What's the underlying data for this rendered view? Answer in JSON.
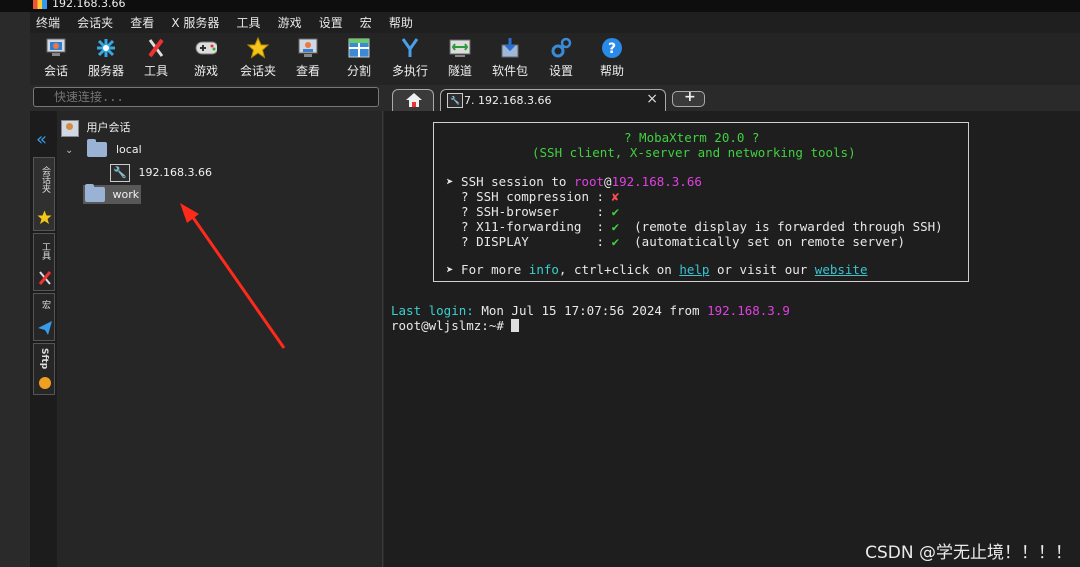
{
  "window": {
    "title": "192.168.3.66"
  },
  "menu": [
    "终端",
    "会话夹",
    "查看",
    "X 服务器",
    "工具",
    "游戏",
    "设置",
    "宏",
    "帮助"
  ],
  "toolbar": [
    {
      "label": "会话",
      "icon": "session-icon"
    },
    {
      "label": "服务器",
      "icon": "servers-icon"
    },
    {
      "label": "工具",
      "icon": "tools-icon"
    },
    {
      "label": "游戏",
      "icon": "games-icon"
    },
    {
      "label": "会话夹",
      "icon": "star-icon"
    },
    {
      "label": "查看",
      "icon": "view-icon"
    },
    {
      "label": "分割",
      "icon": "split-icon"
    },
    {
      "label": "多执行",
      "icon": "multiexec-icon"
    },
    {
      "label": "隧道",
      "icon": "tunnel-icon"
    },
    {
      "label": "软件包",
      "icon": "packages-icon"
    },
    {
      "label": "设置",
      "icon": "settings-icon"
    },
    {
      "label": "帮助",
      "icon": "help-icon"
    }
  ],
  "quick_connect": {
    "placeholder": "快速连接..."
  },
  "side_tabs": [
    "会话夹",
    "工具",
    "宏",
    "Sftp"
  ],
  "tree": {
    "root": "用户会话",
    "folder1": "local",
    "session": "192.168.3.66",
    "folder2": "work"
  },
  "tabs": {
    "active": "7. 192.168.3.66",
    "close": "×"
  },
  "terminal": {
    "banner_title": "? MobaXterm 20.0 ?",
    "banner_sub": "(SSH client, X-server and networking tools)",
    "ssh_prefix": "➤ SSH session to ",
    "ssh_user": "root",
    "ssh_at": "@",
    "ssh_host": "192.168.3.66",
    "f1_label": "  ? SSH compression : ",
    "f1_mark": "✘",
    "f2_label": "  ? SSH-browser     : ",
    "f2_mark": "✔",
    "f3_label": "  ? X11-forwarding  : ",
    "f3_mark": "✔",
    "f3_note": "  (remote display is forwarded through SSH)",
    "f4_label": "  ? DISPLAY         : ",
    "f4_mark": "✔",
    "f4_note": "  (automatically set on remote server)",
    "more_prefix": "➤ For more ",
    "more_info": "info",
    "more_mid": ", ctrl+click on ",
    "more_help": "help",
    "more_or": " or visit our ",
    "more_site": "website",
    "last_login_label": "Last login: ",
    "last_login_text": "Mon Jul 15 17:07:56 2024 from ",
    "last_login_ip": "192.168.3.9",
    "prompt": "root@wljslmz:~# "
  },
  "watermark": "CSDN @学无止境！！！！"
}
